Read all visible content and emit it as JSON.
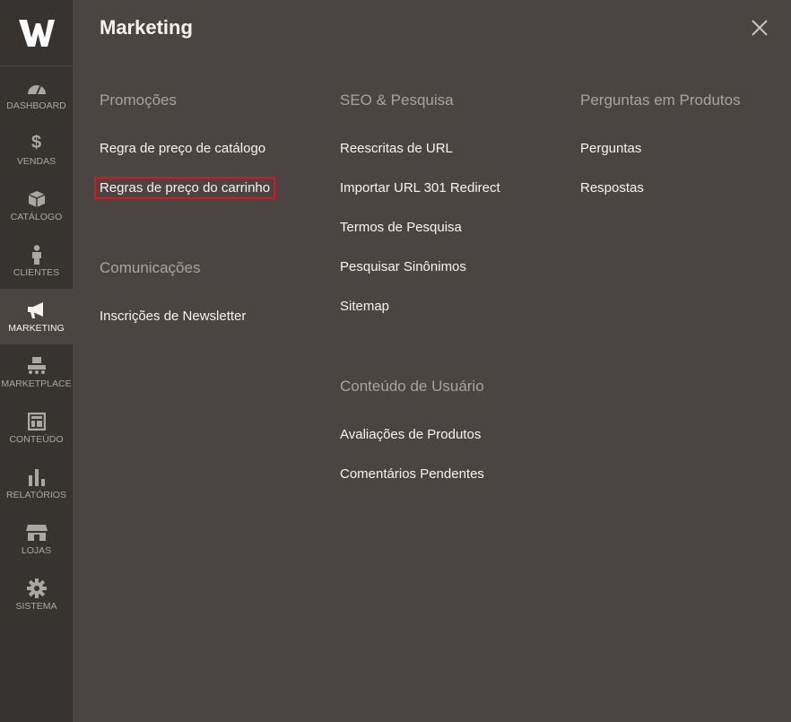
{
  "sidebar": {
    "logo": "W",
    "items": [
      {
        "label": "DASHBOARD",
        "icon": "gauge-icon"
      },
      {
        "label": "VENDAS",
        "icon": "dollar-icon"
      },
      {
        "label": "CATÁLOGO",
        "icon": "box-icon"
      },
      {
        "label": "CLIENTES",
        "icon": "person-icon"
      },
      {
        "label": "MARKETING",
        "icon": "megaphone-icon"
      },
      {
        "label": "MARKETPLACE",
        "icon": "marketplace-icon"
      },
      {
        "label": "CONTEÚDO",
        "icon": "layout-icon"
      },
      {
        "label": "RELATÓRIOS",
        "icon": "bar-chart-icon"
      },
      {
        "label": "LOJAS",
        "icon": "store-icon"
      },
      {
        "label": "SISTEMA",
        "icon": "gear-icon"
      }
    ]
  },
  "panel": {
    "title": "Marketing",
    "groups": {
      "promocoes": {
        "title": "Promoções",
        "links": [
          "Regra de preço de catálogo",
          "Regras de preço do carrinho"
        ]
      },
      "comunicacoes": {
        "title": "Comunicações",
        "links": [
          "Inscrições de Newsletter"
        ]
      },
      "seo": {
        "title": "SEO & Pesquisa",
        "links": [
          "Reescritas de URL",
          "Importar URL 301 Redirect",
          "Termos de Pesquisa",
          "Pesquisar Sinônimos",
          "Sitemap"
        ]
      },
      "conteudo_usuario": {
        "title": "Conteúdo de Usuário",
        "links": [
          "Avaliações de Produtos",
          "Comentários Pendentes"
        ]
      },
      "perguntas": {
        "title": "Perguntas em Produtos",
        "links": [
          "Perguntas",
          "Respostas"
        ]
      }
    }
  },
  "colors": {
    "highlight": "#e3131b",
    "sidebar_bg": "#373330",
    "panel_bg": "#4a4542"
  }
}
